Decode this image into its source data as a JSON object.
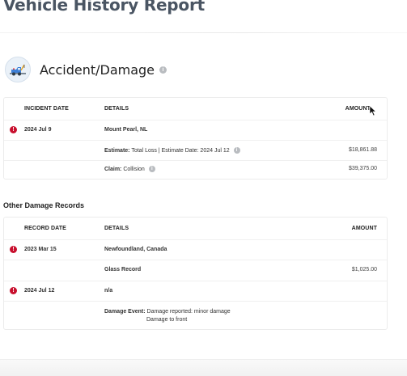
{
  "page": {
    "title": "Vehicle History Report"
  },
  "accident_section": {
    "title": "Accident/Damage",
    "columns": {
      "date": "INCIDENT DATE",
      "details": "DETAILS",
      "amount": "AMOUNT"
    },
    "incident": {
      "date": "2024 Jul 9",
      "location": "Mount Pearl, NL",
      "estimate": {
        "key": "Estimate:",
        "text": "Total Loss | Estimate Date: 2024 Jul 12",
        "amount": "$18,861.88"
      },
      "claim": {
        "key": "Claim:",
        "text": "Collision",
        "amount": "$39,375.00"
      }
    }
  },
  "other_damage": {
    "title": "Other Damage Records",
    "columns": {
      "date": "RECORD DATE",
      "details": "DETAILS",
      "amount": "AMOUNT"
    },
    "records": [
      {
        "date": "2023 Mar 15",
        "details": "Newfoundland, Canada",
        "sub_text": "Glass Record",
        "sub_amount": "$1,025.00"
      },
      {
        "date": "2024 Jul 12",
        "details": "n/a",
        "sub_key": "Damage Event:",
        "sub_line1": "Damage reported: minor damage",
        "sub_line2": "Damage to front"
      }
    ]
  },
  "icons": {
    "section": "tow-truck-icon",
    "info": "info-icon",
    "alert": "alert-icon"
  },
  "colors": {
    "alert": "#c8102e",
    "title": "#4a5563"
  }
}
